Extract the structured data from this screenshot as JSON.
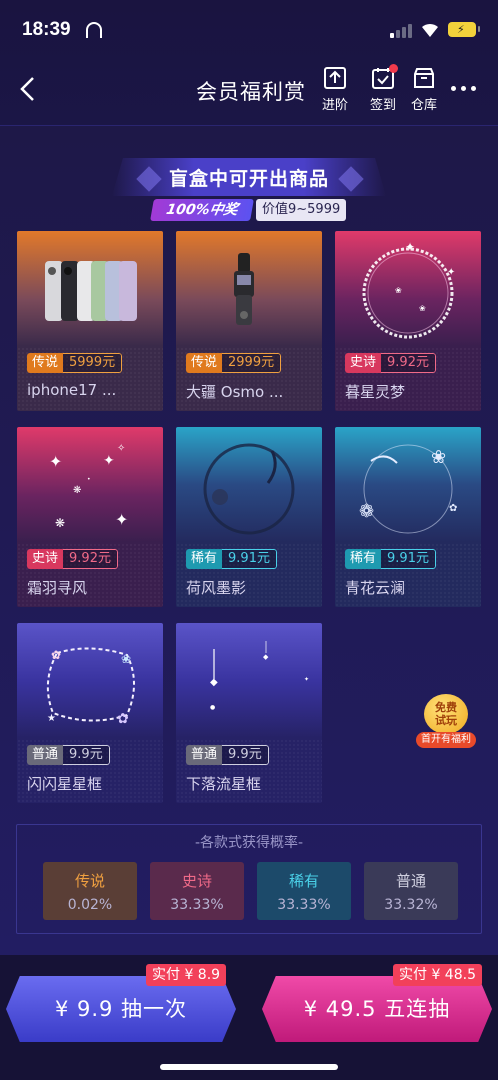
{
  "status_bar": {
    "time": "18:39"
  },
  "nav": {
    "title": "会员福利赏",
    "advance_label": "进阶",
    "checkin_label": "签到",
    "warehouse_label": "仓库"
  },
  "section": {
    "title": "盲盒中可开出商品",
    "win_badge": "100%中奖",
    "value_range": "价值9~5999"
  },
  "items": [
    {
      "tier": "传说",
      "price": "5999元",
      "name": "iphone17 ..."
    },
    {
      "tier": "传说",
      "price": "2999元",
      "name": "大疆 Osmo ..."
    },
    {
      "tier": "史诗",
      "price": "9.92元",
      "name": "暮星灵梦"
    },
    {
      "tier": "史诗",
      "price": "9.92元",
      "name": "霜羽寻风"
    },
    {
      "tier": "稀有",
      "price": "9.91元",
      "name": "荷风墨影"
    },
    {
      "tier": "稀有",
      "price": "9.91元",
      "name": "青花云澜"
    },
    {
      "tier": "普通",
      "price": "9.9元",
      "name": "闪闪星星框"
    },
    {
      "tier": "普通",
      "price": "9.9元",
      "name": "下落流星框"
    }
  ],
  "free_trial": {
    "line1": "免费",
    "line2": "试玩",
    "tag": "首开有福利"
  },
  "probability": {
    "title": "-各款式获得概率-",
    "entries": [
      {
        "tier": "传说",
        "value": "0.02%"
      },
      {
        "tier": "史诗",
        "value": "33.33%"
      },
      {
        "tier": "稀有",
        "value": "33.33%"
      },
      {
        "tier": "普通",
        "value": "33.32%"
      }
    ]
  },
  "buttons": {
    "single_label": "¥ 9.9 抽一次",
    "single_paid": "实付 ¥ 8.9",
    "five_label": "¥ 49.5 五连抽",
    "five_paid": "实付 ¥ 48.5"
  },
  "colors": {
    "legend": "#e07a1e",
    "epic": "#d8385e",
    "rare": "#1e9ab0",
    "normal": "#6a6a7a",
    "single_button": "#5a5ce8",
    "five_button": "#e03a98"
  }
}
